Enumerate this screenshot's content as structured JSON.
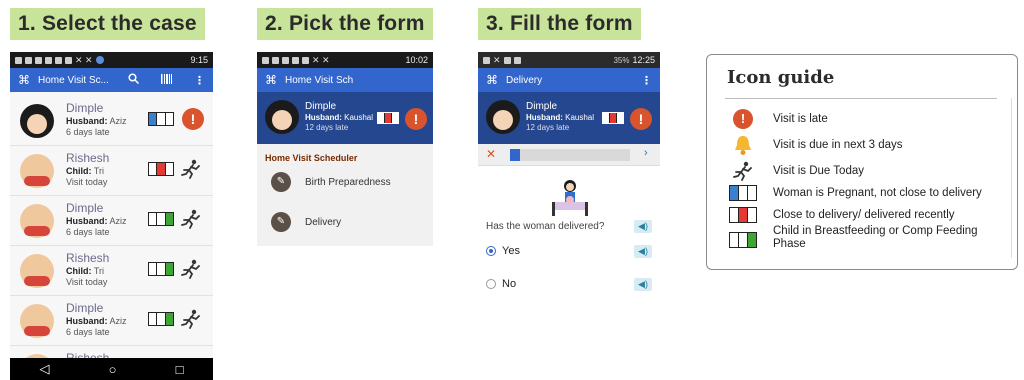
{
  "steps": [
    {
      "label": "1. Select the case"
    },
    {
      "label": "2. Pick the form"
    },
    {
      "label": "3. Fill the form"
    }
  ],
  "colors": {
    "step_bg": "#c8e39a",
    "appbar": "#3366cc",
    "header_dark": "#24478f",
    "alert": "#d9532c",
    "bar_blue": "#3b7fd0",
    "bar_red": "#e53935",
    "bar_green": "#3fa535"
  },
  "phone1": {
    "status_time": "9:15",
    "app_title": "Home Visit Sc...",
    "icons": [
      "app-logo-icon",
      "search-icon",
      "barcode-icon",
      "overflow-menu-icon"
    ],
    "cases": [
      {
        "name": "Dimple",
        "rel_label": "Husband:",
        "rel_value": "Aziz",
        "status": "6 days late",
        "face": "woman",
        "bar_color": "blue",
        "icon": "alert"
      },
      {
        "name": "Rishesh",
        "rel_label": "Child:",
        "rel_value": "Tri",
        "status": "Visit today",
        "face": "baby",
        "bar_color": "red",
        "icon": "run"
      },
      {
        "name": "Dimple",
        "rel_label": "Husband:",
        "rel_value": "Aziz",
        "status": "6 days late",
        "face": "baby",
        "bar_color": "green",
        "icon": "run"
      },
      {
        "name": "Rishesh",
        "rel_label": "Child:",
        "rel_value": "Tri",
        "status": "Visit today",
        "face": "baby",
        "bar_color": "green",
        "icon": "run"
      },
      {
        "name": "Dimple",
        "rel_label": "Husband:",
        "rel_value": "Aziz",
        "status": "6 days late",
        "face": "baby",
        "bar_color": "green",
        "icon": "run"
      },
      {
        "name": "Rishesh",
        "rel_label": "",
        "rel_value": "",
        "status": "",
        "face": "baby",
        "bar_color": "green",
        "icon": "run"
      }
    ],
    "nav": [
      "◁",
      "○",
      "□"
    ]
  },
  "phone2": {
    "status_time": "10:02",
    "app_title": "Home Visit Sch",
    "case": {
      "name": "Dimple",
      "rel_label": "Husband:",
      "rel_value": "Kaushal",
      "status": "12 days late"
    },
    "section_title": "Home Visit Scheduler",
    "forms": [
      {
        "label": "Birth Preparedness"
      },
      {
        "label": "Delivery"
      }
    ]
  },
  "phone3": {
    "status_time": "12:25",
    "status_battery": "35%",
    "app_title": "Delivery",
    "case": {
      "name": "Dimple",
      "rel_label": "Husband:",
      "rel_value": "Kaushal",
      "status": "12 days late"
    },
    "progress": 0.08,
    "question": "Has the woman delivered?",
    "options": [
      {
        "label": "Yes",
        "selected": true
      },
      {
        "label": "No",
        "selected": false
      }
    ]
  },
  "guide": {
    "title": "Icon guide",
    "items": [
      {
        "icon": "alert-icon",
        "text": "Visit is late"
      },
      {
        "icon": "bell-icon",
        "text": "Visit is due in next 3 days"
      },
      {
        "icon": "running-person-icon",
        "text": "Visit is Due Today"
      },
      {
        "icon": "blue-bars-icon",
        "text": "Woman is Pregnant, not close to delivery"
      },
      {
        "icon": "red-bars-icon",
        "text": "Close to delivery/ delivered recently"
      },
      {
        "icon": "green-bars-icon",
        "text": "Child in Breastfeeding or Comp Feeding Phase"
      }
    ]
  }
}
